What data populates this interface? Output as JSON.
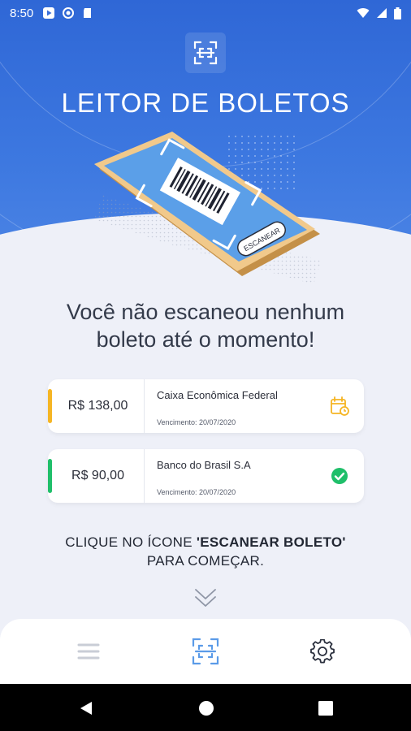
{
  "status_bar": {
    "time": "8:50"
  },
  "app": {
    "title": "LEITOR DE BOLETOS"
  },
  "illustration": {
    "button_label": "ESCANEAR"
  },
  "empty_message": {
    "line1": "Você não escaneou nenhum",
    "line2": "boleto até o momento!"
  },
  "boletos": [
    {
      "amount": "R$ 138,00",
      "bank": "Caixa Econômica Federal",
      "due": "Vencimento: 20/07/2020",
      "status_icon": "calendar-pending-icon",
      "accent": "#f5b524"
    },
    {
      "amount": "R$ 90,00",
      "bank": "Banco do Brasil S.A",
      "due": "Vencimento: 20/07/2020",
      "status_icon": "check-circle-icon",
      "accent": "#1fbf6a"
    }
  ],
  "cta": {
    "prefix": "CLIQUE NO ÍCONE ",
    "highlight": "'ESCANEAR BOLETO'",
    "line2": "PARA COMEÇAR."
  },
  "bottom_nav": {
    "items": [
      "list-icon",
      "scan-icon",
      "settings-icon"
    ],
    "active": "scan-icon"
  },
  "colors": {
    "primary": "#2f67d6",
    "pending": "#f5b524",
    "paid": "#1fbf6a",
    "nav_active": "#5b9be8",
    "nav_inactive": "#c9cdd6"
  }
}
